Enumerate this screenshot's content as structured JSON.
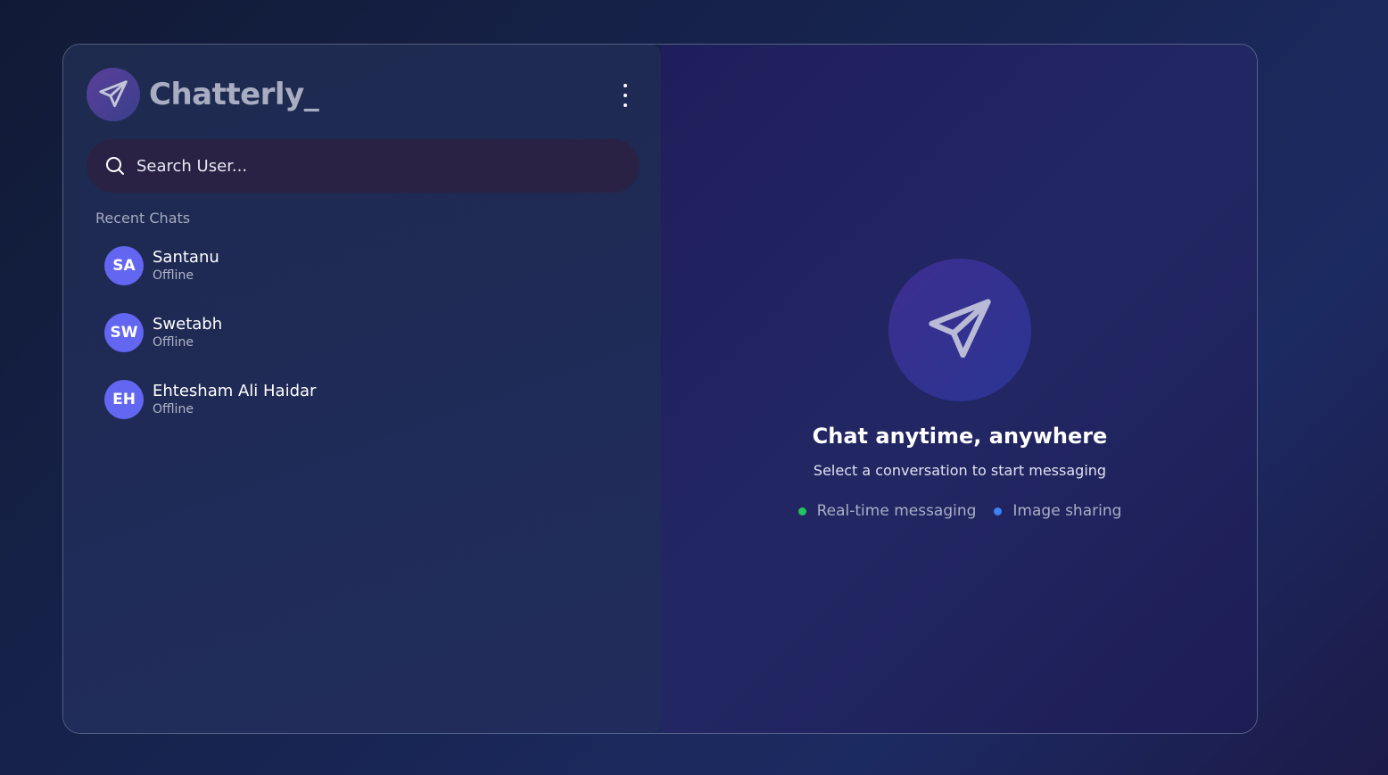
{
  "app": {
    "name": "Chatterly_",
    "logo_icon": "paper-plane-icon"
  },
  "header": {
    "menu_icon": "kebab-menu-icon"
  },
  "search": {
    "placeholder": "Search User...",
    "icon": "search-icon"
  },
  "sidebar": {
    "section_label": "Recent Chats",
    "chats": [
      {
        "initials": "SA",
        "name": "Santanu",
        "status": "Offline"
      },
      {
        "initials": "SW",
        "name": "Swetabh",
        "status": "Offline"
      },
      {
        "initials": "EH",
        "name": "Ehtesham Ali Haidar",
        "status": "Offline"
      }
    ]
  },
  "main": {
    "hero_icon": "paper-plane-icon",
    "title": "Chat anytime, anywhere",
    "subtitle": "Select a conversation to start messaging",
    "features": [
      {
        "label": "Real-time messaging",
        "color": "#22c55e"
      },
      {
        "label": "Image sharing",
        "color": "#3b82f6"
      }
    ]
  },
  "colors": {
    "avatar": "#6366f1",
    "search_bg": "#2a2244"
  }
}
